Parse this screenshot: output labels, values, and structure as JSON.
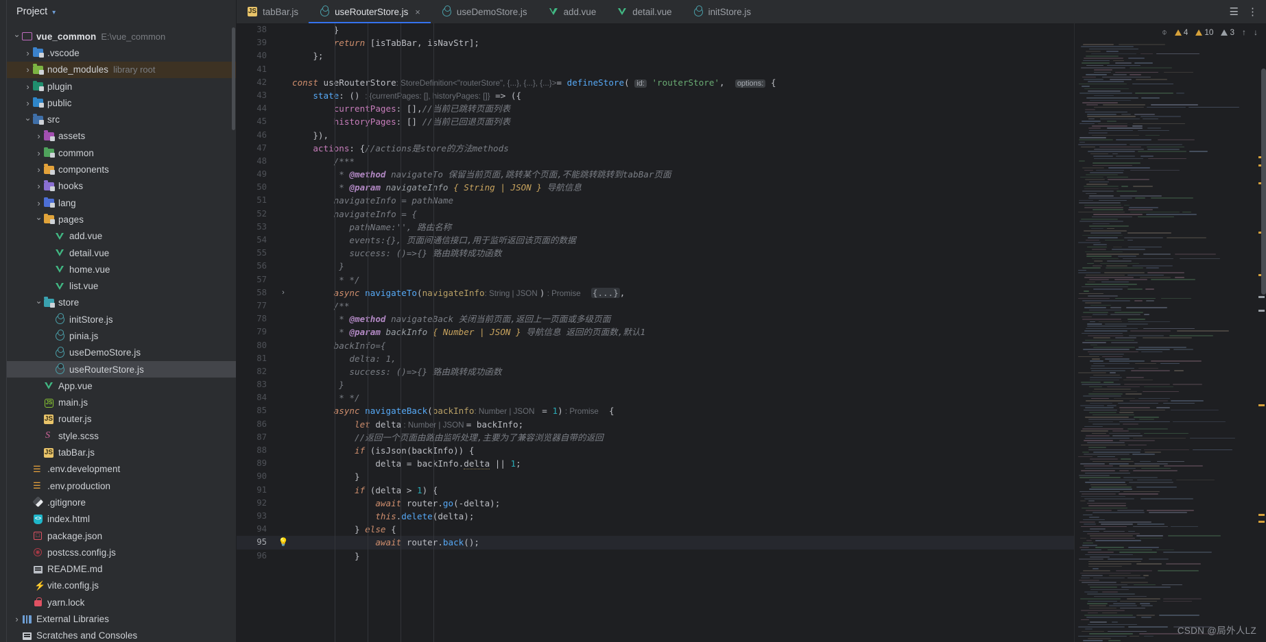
{
  "window": {
    "sidebar_title": "Project",
    "watermark": "CSDN @局外人LZ"
  },
  "sidebar": {
    "header_label": "Project",
    "items": [
      {
        "indent": 0,
        "arrow": "v",
        "icon": "folder-icon",
        "label": "vue_common",
        "sub": "E:\\vue_common",
        "bold": true,
        "state": "normal"
      },
      {
        "indent": 1,
        "arrow": ">",
        "icon": "vscode-folder-icon",
        "label": ".vscode",
        "sub": "",
        "bold": false,
        "state": "normal"
      },
      {
        "indent": 1,
        "arrow": ">",
        "icon": "node-modules-folder-icon",
        "label": "node_modules",
        "sub": "library root",
        "bold": false,
        "state": "highlight"
      },
      {
        "indent": 1,
        "arrow": ">",
        "icon": "plugin-folder-icon",
        "label": "plugin",
        "sub": "",
        "bold": false,
        "state": "normal"
      },
      {
        "indent": 1,
        "arrow": ">",
        "icon": "public-folder-icon",
        "label": "public",
        "sub": "",
        "bold": false,
        "state": "normal"
      },
      {
        "indent": 1,
        "arrow": "v",
        "icon": "source-folder-icon",
        "label": "src",
        "sub": "",
        "bold": false,
        "state": "normal"
      },
      {
        "indent": 2,
        "arrow": ">",
        "icon": "assets-folder-icon",
        "label": "assets",
        "sub": "",
        "bold": false,
        "state": "normal"
      },
      {
        "indent": 2,
        "arrow": ">",
        "icon": "common-folder-icon",
        "label": "common",
        "sub": "",
        "bold": false,
        "state": "normal"
      },
      {
        "indent": 2,
        "arrow": ">",
        "icon": "components-folder-icon",
        "label": "components",
        "sub": "",
        "bold": false,
        "state": "normal"
      },
      {
        "indent": 2,
        "arrow": ">",
        "icon": "hooks-folder-icon",
        "label": "hooks",
        "sub": "",
        "bold": false,
        "state": "normal"
      },
      {
        "indent": 2,
        "arrow": ">",
        "icon": "lang-folder-icon",
        "label": "lang",
        "sub": "",
        "bold": false,
        "state": "normal"
      },
      {
        "indent": 2,
        "arrow": "v",
        "icon": "pages-folder-icon",
        "label": "pages",
        "sub": "",
        "bold": false,
        "state": "normal"
      },
      {
        "indent": 3,
        "arrow": "",
        "icon": "vue-file-icon",
        "label": "add.vue",
        "sub": "",
        "bold": false,
        "state": "normal"
      },
      {
        "indent": 3,
        "arrow": "",
        "icon": "vue-file-icon",
        "label": "detail.vue",
        "sub": "",
        "bold": false,
        "state": "normal"
      },
      {
        "indent": 3,
        "arrow": "",
        "icon": "vue-file-icon",
        "label": "home.vue",
        "sub": "",
        "bold": false,
        "state": "normal"
      },
      {
        "indent": 3,
        "arrow": "",
        "icon": "vue-file-icon",
        "label": "list.vue",
        "sub": "",
        "bold": false,
        "state": "normal"
      },
      {
        "indent": 2,
        "arrow": "v",
        "icon": "store-folder-icon",
        "label": "store",
        "sub": "",
        "bold": false,
        "state": "normal"
      },
      {
        "indent": 3,
        "arrow": "",
        "icon": "pinia-file-icon",
        "label": "initStore.js",
        "sub": "",
        "bold": false,
        "state": "normal"
      },
      {
        "indent": 3,
        "arrow": "",
        "icon": "pinia-file-icon",
        "label": "pinia.js",
        "sub": "",
        "bold": false,
        "state": "normal"
      },
      {
        "indent": 3,
        "arrow": "",
        "icon": "pinia-file-icon",
        "label": "useDemoStore.js",
        "sub": "",
        "bold": false,
        "state": "normal"
      },
      {
        "indent": 3,
        "arrow": "",
        "icon": "pinia-file-icon",
        "label": "useRouterStore.js",
        "sub": "",
        "bold": false,
        "state": "selected"
      },
      {
        "indent": 2,
        "arrow": "",
        "icon": "vue-file-icon",
        "label": "App.vue",
        "sub": "",
        "bold": false,
        "state": "normal"
      },
      {
        "indent": 2,
        "arrow": "",
        "icon": "node-js-file-icon",
        "label": "main.js",
        "sub": "",
        "bold": false,
        "state": "normal"
      },
      {
        "indent": 2,
        "arrow": "",
        "icon": "js-file-icon",
        "label": "router.js",
        "sub": "",
        "bold": false,
        "state": "normal"
      },
      {
        "indent": 2,
        "arrow": "",
        "icon": "scss-file-icon",
        "label": "style.scss",
        "sub": "",
        "bold": false,
        "state": "normal"
      },
      {
        "indent": 2,
        "arrow": "",
        "icon": "js-file-icon",
        "label": "tabBar.js",
        "sub": "",
        "bold": false,
        "state": "normal"
      },
      {
        "indent": 1,
        "arrow": "",
        "icon": "env-file-icon",
        "label": ".env.development",
        "sub": "",
        "bold": false,
        "state": "normal"
      },
      {
        "indent": 1,
        "arrow": "",
        "icon": "env-file-icon",
        "label": ".env.production",
        "sub": "",
        "bold": false,
        "state": "normal"
      },
      {
        "indent": 1,
        "arrow": "",
        "icon": "gitignore-file-icon",
        "label": ".gitignore",
        "sub": "",
        "bold": false,
        "state": "normal"
      },
      {
        "indent": 1,
        "arrow": "",
        "icon": "html-file-icon",
        "label": "index.html",
        "sub": "",
        "bold": false,
        "state": "normal"
      },
      {
        "indent": 1,
        "arrow": "",
        "icon": "json-file-icon",
        "label": "package.json",
        "sub": "",
        "bold": false,
        "state": "normal"
      },
      {
        "indent": 1,
        "arrow": "",
        "icon": "postcss-file-icon",
        "label": "postcss.config.js",
        "sub": "",
        "bold": false,
        "state": "normal"
      },
      {
        "indent": 1,
        "arrow": "",
        "icon": "readme-file-icon",
        "label": "README.md",
        "sub": "",
        "bold": false,
        "state": "normal"
      },
      {
        "indent": 1,
        "arrow": "",
        "icon": "vite-config-file-icon",
        "label": "vite.config.js",
        "sub": "",
        "bold": false,
        "state": "normal"
      },
      {
        "indent": 1,
        "arrow": "",
        "icon": "lock-file-icon",
        "label": "yarn.lock",
        "sub": "",
        "bold": false,
        "state": "normal"
      },
      {
        "indent": 0,
        "arrow": ">",
        "icon": "external-libraries-icon",
        "label": "External Libraries",
        "sub": "",
        "bold": false,
        "state": "normal"
      },
      {
        "indent": 0,
        "arrow": "",
        "icon": "scratches-icon",
        "label": "Scratches and Consoles",
        "sub": "",
        "bold": false,
        "state": "normal"
      }
    ]
  },
  "tabs": [
    {
      "label": "tabBar.js",
      "icon": "js-file-icon",
      "active": false,
      "closable": false
    },
    {
      "label": "useRouterStore.js",
      "icon": "pinia-file-icon",
      "active": true,
      "closable": true,
      "close_label": "×"
    },
    {
      "label": "useDemoStore.js",
      "icon": "pinia-file-icon",
      "active": false,
      "closable": false
    },
    {
      "label": "add.vue",
      "icon": "vue-file-icon",
      "active": false,
      "closable": false
    },
    {
      "label": "detail.vue",
      "icon": "vue-file-icon",
      "active": false,
      "closable": false
    },
    {
      "label": "initStore.js",
      "icon": "pinia-file-icon",
      "active": false,
      "closable": false
    }
  ],
  "tabbar_right": {
    "settings_icon": "☰",
    "more_icon": "⋮"
  },
  "inspection": {
    "eye_icon": "⌽",
    "warnings_count": "4",
    "weak_warnings_count": "10",
    "typos_count": "3",
    "prev_icon": "↑",
    "next_icon": "↓"
  },
  "code": {
    "lines": [
      {
        "n": "38",
        "cur": false,
        "marker": "",
        "indent": 1
      },
      {
        "n": "39",
        "cur": false,
        "marker": "",
        "indent": 1
      },
      {
        "n": "40",
        "cur": false,
        "marker": "",
        "indent": 0
      },
      {
        "n": "41",
        "cur": false,
        "marker": "",
        "indent": 0
      },
      {
        "n": "42",
        "cur": false,
        "marker": "",
        "indent": 0
      },
      {
        "n": "43",
        "cur": false,
        "marker": "",
        "indent": 1
      },
      {
        "n": "44",
        "cur": false,
        "marker": "",
        "indent": 2
      },
      {
        "n": "45",
        "cur": false,
        "marker": "",
        "indent": 2
      },
      {
        "n": "46",
        "cur": false,
        "marker": "",
        "indent": 1
      },
      {
        "n": "47",
        "cur": false,
        "marker": "",
        "indent": 1
      },
      {
        "n": "48",
        "cur": false,
        "marker": "",
        "indent": 2
      },
      {
        "n": "49",
        "cur": false,
        "marker": "",
        "indent": 2
      },
      {
        "n": "50",
        "cur": false,
        "marker": "",
        "indent": 2
      },
      {
        "n": "51",
        "cur": false,
        "marker": "",
        "indent": 2
      },
      {
        "n": "52",
        "cur": false,
        "marker": "",
        "indent": 2
      },
      {
        "n": "53",
        "cur": false,
        "marker": "",
        "indent": 3
      },
      {
        "n": "54",
        "cur": false,
        "marker": "",
        "indent": 3
      },
      {
        "n": "55",
        "cur": false,
        "marker": "",
        "indent": 3
      },
      {
        "n": "56",
        "cur": false,
        "marker": "",
        "indent": 2
      },
      {
        "n": "57",
        "cur": false,
        "marker": "",
        "indent": 2
      },
      {
        "n": "58",
        "cur": false,
        "marker": "expander",
        "indent": 2
      },
      {
        "n": "77",
        "cur": false,
        "marker": "",
        "indent": 2
      },
      {
        "n": "78",
        "cur": false,
        "marker": "",
        "indent": 2
      },
      {
        "n": "79",
        "cur": false,
        "marker": "",
        "indent": 2
      },
      {
        "n": "80",
        "cur": false,
        "marker": "",
        "indent": 2
      },
      {
        "n": "81",
        "cur": false,
        "marker": "",
        "indent": 3
      },
      {
        "n": "82",
        "cur": false,
        "marker": "",
        "indent": 3
      },
      {
        "n": "83",
        "cur": false,
        "marker": "",
        "indent": 2
      },
      {
        "n": "84",
        "cur": false,
        "marker": "",
        "indent": 2
      },
      {
        "n": "85",
        "cur": false,
        "marker": "",
        "indent": 2
      },
      {
        "n": "86",
        "cur": false,
        "marker": "",
        "indent": 3
      },
      {
        "n": "87",
        "cur": false,
        "marker": "",
        "indent": 3
      },
      {
        "n": "88",
        "cur": false,
        "marker": "",
        "indent": 3
      },
      {
        "n": "89",
        "cur": false,
        "marker": "",
        "indent": 4
      },
      {
        "n": "90",
        "cur": false,
        "marker": "",
        "indent": 3
      },
      {
        "n": "91",
        "cur": false,
        "marker": "",
        "indent": 3
      },
      {
        "n": "92",
        "cur": false,
        "marker": "",
        "indent": 4
      },
      {
        "n": "93",
        "cur": false,
        "marker": "",
        "indent": 4
      },
      {
        "n": "94",
        "cur": false,
        "marker": "",
        "indent": 3
      },
      {
        "n": "95",
        "cur": true,
        "marker": "bulb",
        "indent": 4
      },
      {
        "n": "96",
        "cur": false,
        "marker": "",
        "indent": 3
      }
    ],
    "text": {
      "l38": "}",
      "l39_kw": "return",
      "l39_rest": " [isTabBar, isNavStr];",
      "l40": "};",
      "l42_const": "const",
      "l42_name": "useRouterStore",
      "l42_type": ": StoreDefinition<\"routerStore\", {...}, {...}, {...}>",
      "l42_eq": "= ",
      "l42_fn": "defineStore",
      "l42_paren": "(",
      "l42_pill": "id:",
      "l42_str": "'routerStore'",
      "l42_comma": ",",
      "l42_pill2": "options:",
      "l42_brace": "{",
      "l43_prop": "state",
      "l43_rest": ": () ",
      "l43_type": ": {currentPages: [], historyPages: []}",
      "l43_arrow": " => ({",
      "l44_prop": "currentPages",
      "l44_val": ": [],",
      "l44_cmt": "//当前已跳转页面列表",
      "l45_prop": "historyPages",
      "l45_val": ": [] ",
      "l45_cmt": "//当前已回退页面列表",
      "l46": "}),",
      "l47_prop": "actions",
      "l47_val": ": {",
      "l47_cmt": "//actions是store的方法methods",
      "l48": "/***",
      "l49_star": "* ",
      "l49_tag": "@method",
      "l49_name": " navigateTo ",
      "l49_desc": "保留当前页面,跳转某个页面,不能跳转跳转到tabBar页面",
      "l50_star": "* ",
      "l50_tag": "@param",
      "l50_name": " navigateInfo ",
      "l50_type": "{ String | JSON }",
      "l50_desc": " 导航信息",
      "l51": "navigateInfo = pathName",
      "l52": "navigateInfo = {",
      "l53_code": "pathName:'', ",
      "l53_desc": "路由名称",
      "l54_code": "events:{}, ",
      "l54_desc": "页面间通信接口,用于监听返回该页面的数据",
      "l55_code": "success: ()=>{} ",
      "l55_desc": "路由跳转成功函数",
      "l56": "}",
      "l57": "* */",
      "l58_async": "async",
      "l58_name": " navigateTo",
      "l58_paren": "(",
      "l58_param": "navigateInfo",
      "l58_type": ": String | JSON ",
      "l58_close": ")",
      "l58_ret": " : Promise<void>",
      "l58_fold": "{...}",
      "l58_comma": ",",
      "l77": "/**",
      "l78_star": "* ",
      "l78_tag": "@method",
      "l78_name": " navigateBack ",
      "l78_desc": "关闭当前页面,返回上一页面或多级页面",
      "l79_star": "* ",
      "l79_tag": "@param",
      "l79_name": " backInfo ",
      "l79_type": "{ Number | JSON }",
      "l79_desc": " 导航信息 返回的页面数,默认1",
      "l80": "backInfo={",
      "l81": "delta: 1,",
      "l82_code": "success: ()=>{} ",
      "l82_desc": "路由跳转成功函数",
      "l83": "}",
      "l84": "* */",
      "l85_async": "async",
      "l85_name": " navigateBack",
      "l85_paren": "(",
      "l85_param": "backInfo",
      "l85_type": ": Number | JSON ",
      "l85_eq": " = 1",
      "l85_close": ")",
      "l85_ret": " : Promise<void>",
      "l85_brace": "  {",
      "l86_kw": "let",
      "l86_name": " delta",
      "l86_type": " : Number | JSON ",
      "l86_rest": "= backInfo;",
      "l87_cmt": "//返回一个页面由路由监听处理,主要为了兼容浏览器自带的返回",
      "l88_kw": "if",
      "l88_rest": " (isJson(backInfo)) {",
      "l89_a": "delta = backInfo.",
      "l89_b": "delta",
      "l89_c": " || ",
      "l89_n": "1",
      "l89_d": ";",
      "l90": "}",
      "l91_kw": "if",
      "l91_rest": " (delta > ",
      "l91_n": "1",
      "l91_end": ") {",
      "l92_kw": "await",
      "l92_a": " router.",
      "l92_b": "go",
      "l92_c": "(-delta);",
      "l93_kw": "this",
      "l93_a": ".",
      "l93_b": "delete",
      "l93_c": "(delta);",
      "l94": "} ",
      "l94_kw": "else",
      "l94_end": " {",
      "l95_kw": "await",
      "l95_a": " router.",
      "l95_b": "back",
      "l95_c": "();",
      "l96": "}"
    }
  },
  "colors": {
    "accent": "#3573f0",
    "editor_bg": "#1e1f22",
    "panel_bg": "#2b2d30",
    "selection": "#43454a",
    "warning": "#d6a13a",
    "string": "#6aab73",
    "keyword": "#cf8e6d",
    "function": "#56a8f5",
    "number": "#2aacb8",
    "comment": "#7a7e85"
  }
}
